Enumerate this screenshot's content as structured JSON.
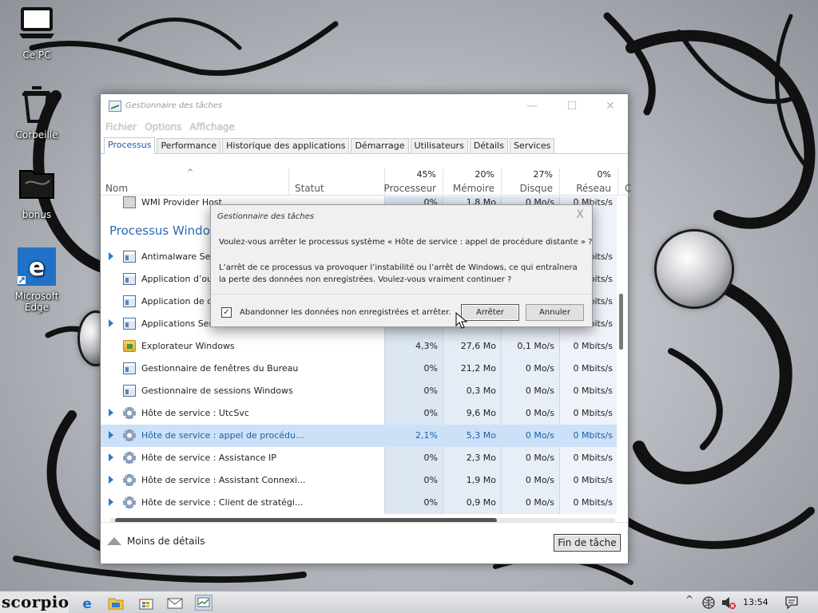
{
  "desktop": {
    "icons": [
      {
        "label": "Ce PC",
        "icon": "laptop-icon"
      },
      {
        "label": "Corbeille",
        "icon": "recycle-bin-icon"
      },
      {
        "label": "bonus",
        "icon": "folder-icon"
      },
      {
        "label": "Microsoft Edge",
        "icon": "edge-icon"
      }
    ]
  },
  "taskmgr": {
    "title": "Gestionnaire des tâches",
    "menu": [
      "Fichier",
      "Options",
      "Affichage"
    ],
    "tabs": [
      "Processus",
      "Performance",
      "Historique des applications",
      "Démarrage",
      "Utilisateurs",
      "Détails",
      "Services"
    ],
    "active_tab": "Processus",
    "columns": {
      "name": "Nom",
      "status": "Statut",
      "cpu": {
        "pct": "45%",
        "label": "Processeur"
      },
      "mem": {
        "pct": "20%",
        "label": "Mémoire"
      },
      "disk": {
        "pct": "27%",
        "label": "Disque"
      },
      "net": {
        "pct": "0%",
        "label": "Réseau"
      },
      "more": "C"
    },
    "top_row": {
      "name": "WMI Provider Host",
      "cpu": "0%",
      "mem": "1,8 Mo",
      "disk": "0 Mo/s",
      "net": "0 Mbits/s"
    },
    "group_title": "Processus Windows",
    "rows": [
      {
        "name": "Antimalware Service Executable",
        "cpu": "",
        "mem": "",
        "disk": "",
        "net": "0 Mbits/s",
        "expand": true,
        "icon": "window"
      },
      {
        "name": "Application d’ouverture de session Windows",
        "cpu": "",
        "mem": "",
        "disk": "",
        "net": "0 Mbits/s",
        "expand": false,
        "icon": "window"
      },
      {
        "name": "Application de démarrage de Windows",
        "cpu": "",
        "mem": "",
        "disk": "",
        "net": "0 Mbits/s",
        "expand": false,
        "icon": "window"
      },
      {
        "name": "Applications Services",
        "cpu": "",
        "mem": "",
        "disk": "",
        "net": "0 Mbits/s",
        "expand": true,
        "icon": "window"
      },
      {
        "name": "Explorateur Windows",
        "cpu": "4,3%",
        "mem": "27,6 Mo",
        "disk": "0,1 Mo/s",
        "net": "0 Mbits/s",
        "expand": false,
        "icon": "folder"
      },
      {
        "name": "Gestionnaire de fenêtres du Bureau",
        "cpu": "0%",
        "mem": "21,2 Mo",
        "disk": "0 Mo/s",
        "net": "0 Mbits/s",
        "expand": false,
        "icon": "window"
      },
      {
        "name": "Gestionnaire de sessions Windows",
        "cpu": "0%",
        "mem": "0,3 Mo",
        "disk": "0 Mo/s",
        "net": "0 Mbits/s",
        "expand": false,
        "icon": "window"
      },
      {
        "name": "Hôte de service : UtcSvc",
        "cpu": "0%",
        "mem": "9,6 Mo",
        "disk": "0 Mo/s",
        "net": "0 Mbits/s",
        "expand": true,
        "icon": "gear"
      },
      {
        "name": "Hôte de service : appel de procédu...",
        "cpu": "2,1%",
        "mem": "5,3 Mo",
        "disk": "0 Mo/s",
        "net": "0 Mbits/s",
        "expand": true,
        "icon": "gear",
        "selected": true
      },
      {
        "name": "Hôte de service : Assistance IP",
        "cpu": "0%",
        "mem": "2,3 Mo",
        "disk": "0 Mo/s",
        "net": "0 Mbits/s",
        "expand": true,
        "icon": "gear"
      },
      {
        "name": "Hôte de service : Assistant Connexi...",
        "cpu": "0%",
        "mem": "1,9 Mo",
        "disk": "0 Mo/s",
        "net": "0 Mbits/s",
        "expand": true,
        "icon": "gear"
      },
      {
        "name": "Hôte de service : Client de stratégi...",
        "cpu": "0%",
        "mem": "0,9 Mo",
        "disk": "0 Mo/s",
        "net": "0 Mbits/s",
        "expand": true,
        "icon": "gear"
      }
    ],
    "footer": {
      "less_details": "Moins de détails",
      "end_task": "Fin de tâche"
    }
  },
  "dialog": {
    "title": "Gestionnaire des tâches",
    "question": "Voulez-vous arrêter le processus système « Hôte de service : appel de procédure distante » ?",
    "warning": "L’arrêt de ce processus va provoquer l’instabilité ou l’arrêt de Windows, ce qui entraînera la perte des données non enregistrées. Voulez-vous vraiment continuer ?",
    "checkbox_label": "Abandonner les données non enregistrées et arrêter.",
    "checkbox_checked": true,
    "checkmark": "✓",
    "close": "X",
    "stop": "Arrêter",
    "cancel": "Annuler"
  },
  "taskbar": {
    "start_label": "scorpio",
    "apps": [
      "edge-icon",
      "file-explorer-icon",
      "store-icon",
      "mail-icon",
      "task-manager-icon"
    ],
    "clock": "13:54"
  },
  "colors": {
    "accent": "#1c5fa8",
    "selected_row": "#cce1f7",
    "column_highlight": "#dde7f3"
  }
}
